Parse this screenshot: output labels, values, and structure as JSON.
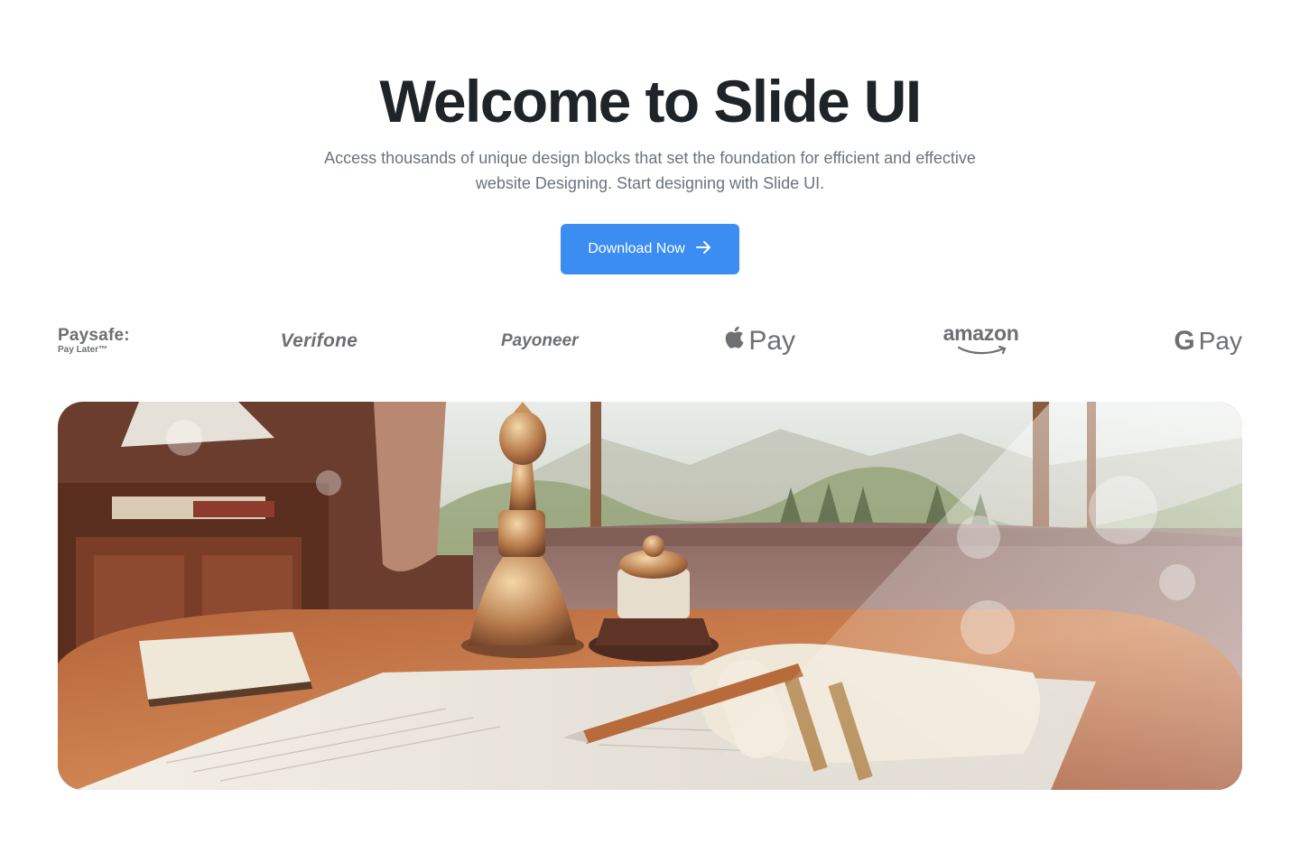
{
  "hero": {
    "title": "Welcome to Slide UI",
    "subtitle": "Access thousands of unique design blocks that set the foundation for efficient and effective website Designing. Start designing with Slide UI.",
    "cta_label": "Download Now",
    "cta_icon": "arrow-right-icon"
  },
  "logos": {
    "paysafe_main": "Paysafe:",
    "paysafe_sub": "Pay Later™",
    "verifone": "Verifone",
    "payoneer": "Payoneer",
    "applepay": "Pay",
    "amazon": "amazon",
    "gpay_g": "G",
    "gpay": "Pay"
  },
  "colors": {
    "accent": "#3b8df2",
    "title": "#1f2429",
    "muted": "#6b7280",
    "logo": "#6d6f73"
  }
}
